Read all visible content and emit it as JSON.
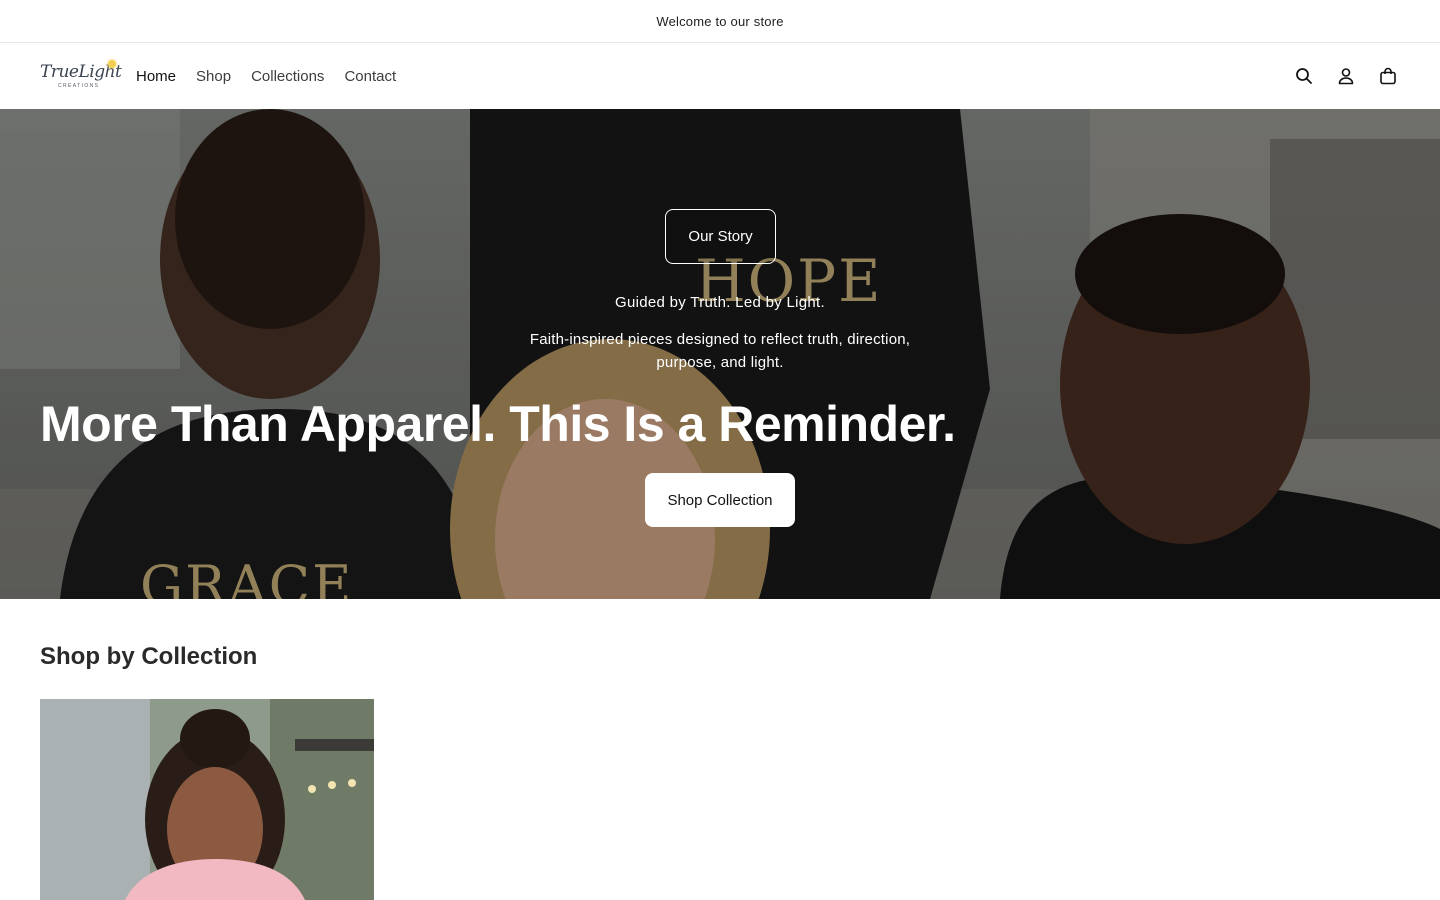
{
  "announcement": {
    "text": "Welcome to our store"
  },
  "header": {
    "logo": {
      "script": "TrueLight",
      "sub": "CREATIONS"
    },
    "nav": [
      {
        "label": "Home",
        "active": true
      },
      {
        "label": "Shop",
        "active": false
      },
      {
        "label": "Collections",
        "active": false
      },
      {
        "label": "Contact",
        "active": false
      }
    ],
    "icons": [
      "search-icon",
      "account-icon",
      "cart-icon"
    ]
  },
  "hero": {
    "story_button": "Our Story",
    "tagline": "Guided by Truth. Led by Light.",
    "description": "Faith-inspired pieces designed to reflect truth, direction, purpose, and light.",
    "headline": "More Than Apparel. This Is a Reminder.",
    "cta_button": "Shop Collection",
    "image_text": {
      "shirt_center": "HOPE",
      "shirt_left": "GRACE"
    }
  },
  "collections": {
    "title": "Shop by Collection"
  },
  "colors": {
    "text": "#121212",
    "white": "#ffffff",
    "accent_gold": "#c9b27a"
  }
}
